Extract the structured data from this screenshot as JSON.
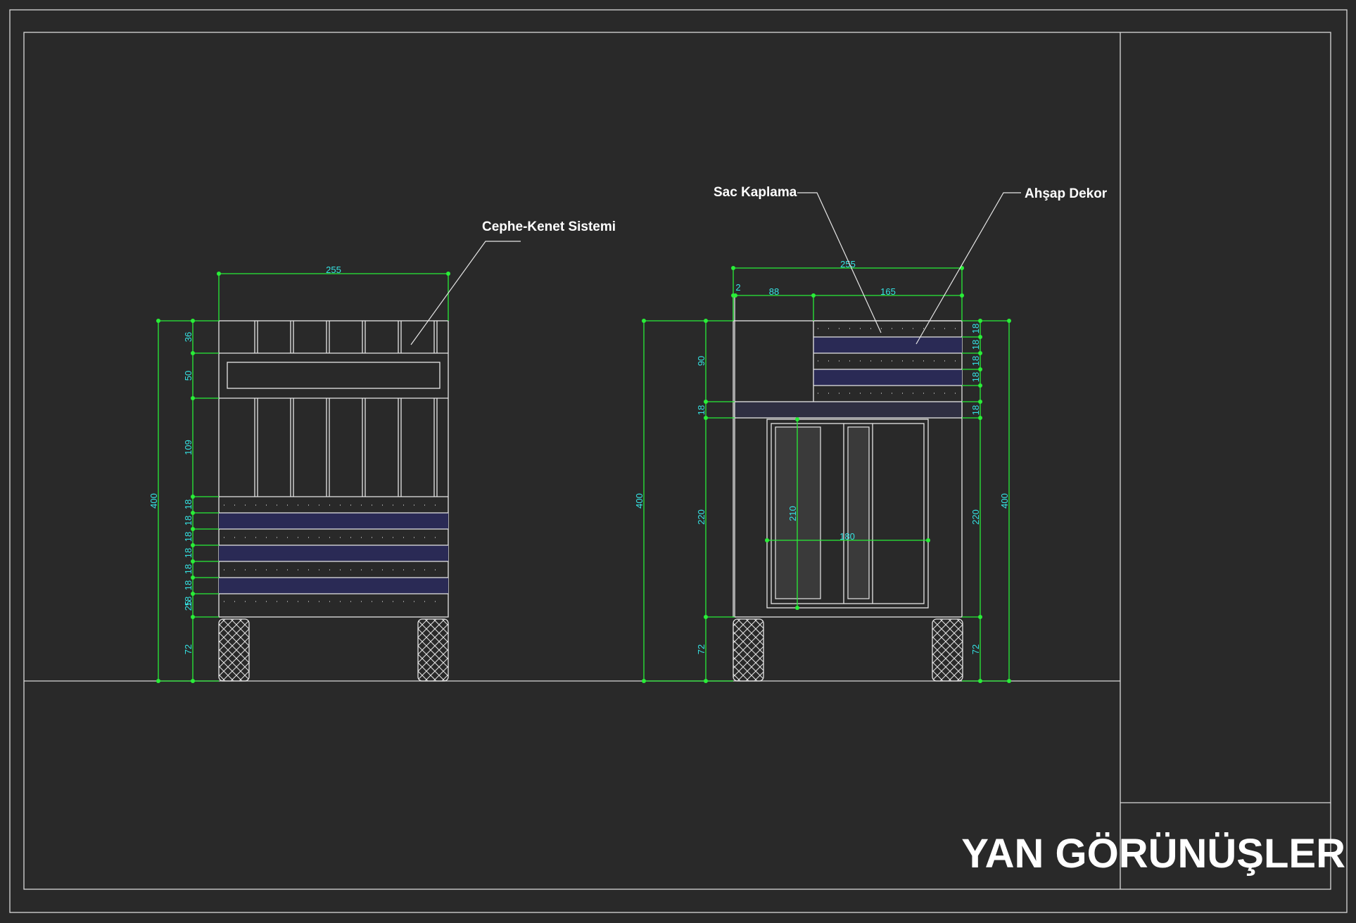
{
  "sheet": {
    "title": "YAN GÖRÜNÜŞLER"
  },
  "labels": {
    "cephe_kenet": "Cephe-Kenet Sistemi",
    "sac_kaplama": "Sac Kaplama",
    "ahsap_dekor": "Ahşap Dekor"
  },
  "colors": {
    "background": "#292929",
    "linework": "#e6e6e6",
    "dimension_lines": "#29ee38",
    "dimension_text": "#35e3e3",
    "wood_slat": "#2a2a55"
  },
  "left_view": {
    "width": "255",
    "total_height": "400",
    "segments": [
      "36",
      "50",
      "109",
      "18",
      "18",
      "18",
      "18",
      "18",
      "18",
      "18",
      "25",
      "72"
    ]
  },
  "right_view": {
    "width": "255",
    "gap": "2",
    "left_part": "88",
    "right_part": "165",
    "left_total": "400",
    "right_total": "400",
    "left_segments": [
      "90",
      "18",
      "220",
      "72"
    ],
    "right_segments": [
      "18",
      "18",
      "18",
      "18",
      "18",
      "220",
      "72"
    ],
    "door_height": "210",
    "door_width": "180"
  }
}
